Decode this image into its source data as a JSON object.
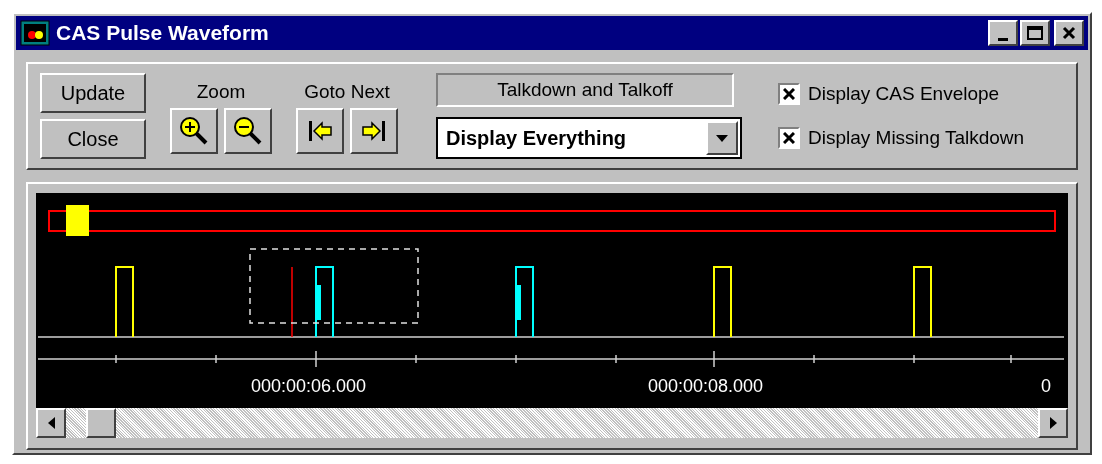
{
  "window": {
    "title": "CAS Pulse Waveform"
  },
  "buttons": [
    {
      "label": "Update"
    },
    {
      "label": "Close"
    }
  ],
  "zoom": {
    "label": "Zoom"
  },
  "goto_next": {
    "label": "Goto Next"
  },
  "filter": {
    "label": "Talkdown and Talkoff",
    "value": "Display Everything"
  },
  "checkboxes": [
    {
      "label": "Display CAS Envelope",
      "checked": true
    },
    {
      "label": "Display Missing Talkdown",
      "checked": true
    }
  ],
  "time_labels": [
    "000:00:06.000",
    "000:00:08.000",
    "0"
  ]
}
